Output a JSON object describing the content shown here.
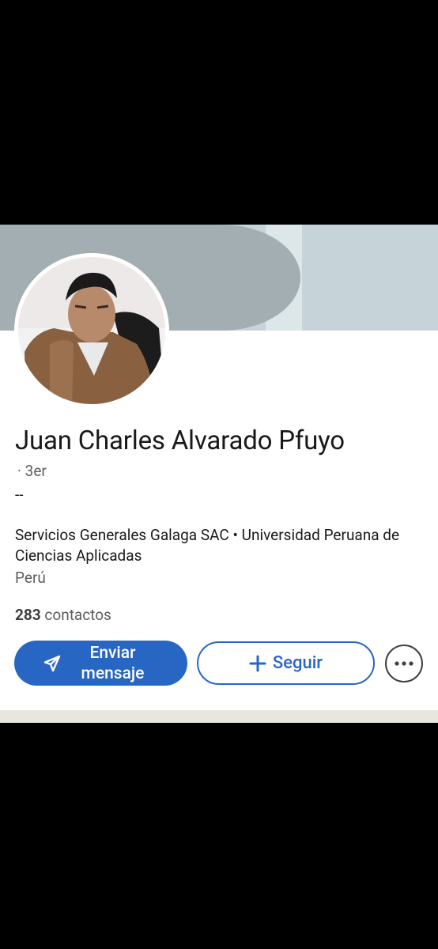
{
  "profile": {
    "name": "Juan Charles Alvarado Pfuyo",
    "degree": "· 3er",
    "headline": "--",
    "education": "Servicios Generales Galaga SAC • Universidad Peruana de Ciencias Aplicadas",
    "location": "Perú",
    "connections_count": "283",
    "connections_label": " contactos"
  },
  "actions": {
    "message_label": "Enviar mensaje",
    "follow_label": "Seguir",
    "more_icon": "ellipsis-icon",
    "send_icon": "send-icon",
    "plus_icon": "plus-icon"
  },
  "colors": {
    "accent": "#2866c3",
    "banner_dark": "#a2aeb2",
    "banner_light": "#c6d3d8"
  }
}
